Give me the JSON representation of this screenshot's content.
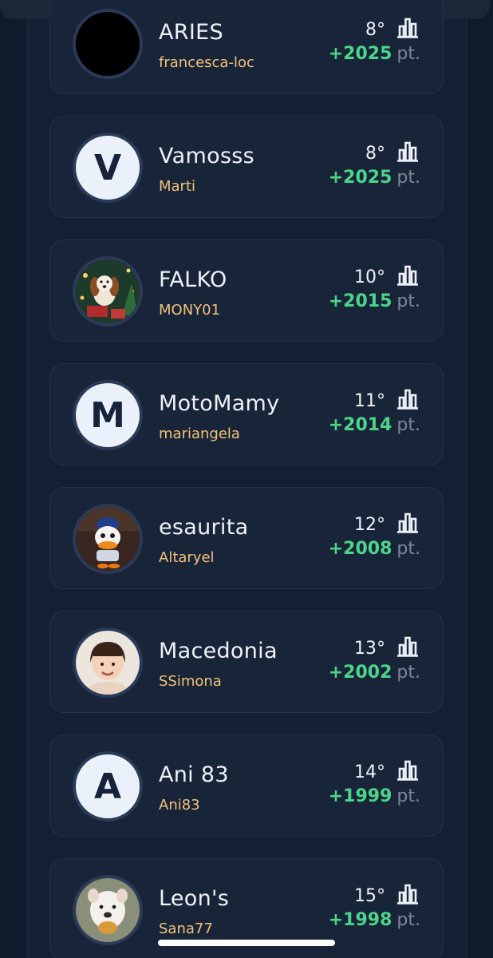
{
  "leaderboard": {
    "points_unit": "pt.",
    "entries": [
      {
        "team": "ARIES",
        "user": "francesca-loc",
        "rank": "8°",
        "points": "+2025",
        "avatar": "black-circle"
      },
      {
        "team": "Vamosss",
        "user": "Marti",
        "rank": "8°",
        "points": "+2025",
        "avatar": "letter",
        "letter": "V"
      },
      {
        "team": "FALKO",
        "user": "MONY01",
        "rank": "10°",
        "points": "+2015",
        "avatar": "photo-dog-christmas"
      },
      {
        "team": "MotoMamy",
        "user": "mariangela",
        "rank": "11°",
        "points": "+2014",
        "avatar": "letter",
        "letter": "M"
      },
      {
        "team": "esaurita",
        "user": "Altaryel",
        "rank": "12°",
        "points": "+2008",
        "avatar": "photo-duck-figure"
      },
      {
        "team": "Macedonia",
        "user": "SSimona",
        "rank": "13°",
        "points": "+2002",
        "avatar": "photo-child"
      },
      {
        "team": "Ani 83",
        "user": "Ani83",
        "rank": "14°",
        "points": "+1999",
        "avatar": "letter",
        "letter": "A"
      },
      {
        "team": "Leon's",
        "user": "Sana77",
        "rank": "15°",
        "points": "+1998",
        "avatar": "photo-bulldog"
      }
    ]
  },
  "icons": {
    "stats": "bar-chart-icon"
  },
  "colors": {
    "background": "#0f1a2c",
    "card": "#182438",
    "username": "#f4c27a",
    "points": "#4cd58a"
  }
}
